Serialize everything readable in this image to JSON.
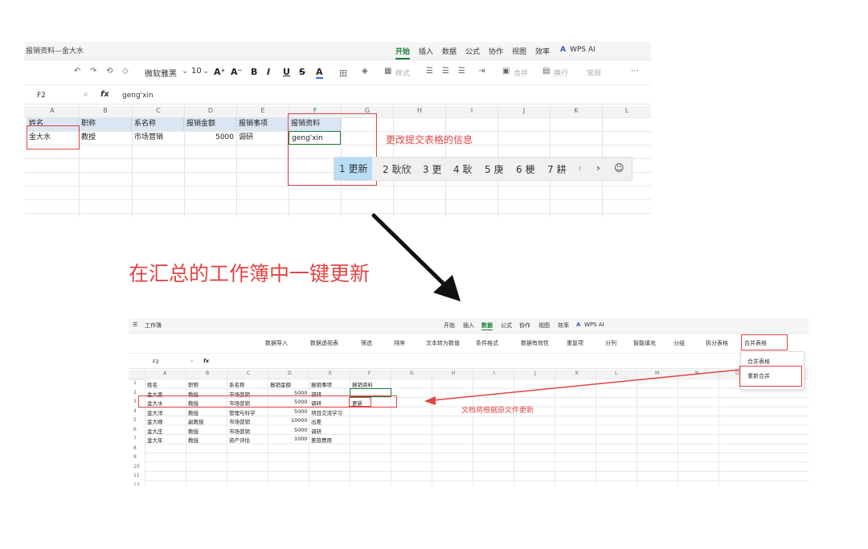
{
  "top": {
    "doc_title": "报销资料—金大水",
    "menu": [
      "开始",
      "插入",
      "数据",
      "公式",
      "协作",
      "视图",
      "效率",
      "WPS AI"
    ],
    "toolbar": {
      "font": "微软雅黑",
      "size": "10",
      "grow": "A⁺",
      "shrink": "A⁻",
      "bold": "B",
      "italic": "I",
      "underline": "U",
      "strike": "S",
      "color": "A",
      "style": "样式",
      "merge": "合并",
      "wrap": "换行",
      "format": "常规"
    },
    "cell_ref": "F2",
    "formula_value": "geng'xin",
    "columns": [
      "A",
      "B",
      "C",
      "D",
      "E",
      "F",
      "G",
      "H",
      "I",
      "J",
      "K",
      "L"
    ],
    "header_row": [
      "姓名",
      "职称",
      "系名称",
      "报销金额",
      "报销事项",
      "报销资料"
    ],
    "data_row": [
      "金大水",
      "教授",
      "市场营销",
      "5000",
      "调研",
      "geng'xin"
    ],
    "ime_candidates": [
      "1 更新",
      "2 耿欣",
      "3 更",
      "4 耿",
      "5 庚",
      "6 梗",
      "7 耕",
      "‹",
      "›",
      "☺"
    ]
  },
  "annotations": {
    "edit_note": "更改提交表格的信息",
    "headline": "在汇总的工作簿中一键更新",
    "update_note": "文档将根据原文件更新"
  },
  "bottom": {
    "title": "工作簿",
    "menu": [
      "开始",
      "插入",
      "数据",
      "公式",
      "协作",
      "视图",
      "效率",
      "WPS AI"
    ],
    "toolbar": [
      "数据导入",
      "数据透视表",
      "筛选",
      "排序",
      "文本转为数值",
      "条件格式",
      "数据有效性",
      "重复项",
      "分列",
      "智能填充",
      "分组",
      "拆分表格",
      "合并表格"
    ],
    "cell_ref": "F2",
    "columns": [
      "A",
      "B",
      "C",
      "D",
      "E",
      "F",
      "G",
      "H",
      "I",
      "J",
      "K",
      "L",
      "M",
      "N",
      "O"
    ],
    "rows": [
      [
        "姓名",
        "职称",
        "系名称",
        "报销金额",
        "报销事项",
        "报销资料"
      ],
      [
        "金大姜",
        "教授",
        "市场营销",
        "5000",
        "调研",
        ""
      ],
      [
        "金大水",
        "教授",
        "市场营销",
        "5000",
        "调研",
        "更新"
      ],
      [
        "金大洋",
        "教授",
        "管理与科学",
        "5000",
        "项目交流学习",
        ""
      ],
      [
        "金大顺",
        "副教授",
        "市场营销",
        "10000",
        "出差",
        ""
      ],
      [
        "金大庄",
        "教授",
        "市场营销",
        "5000",
        "调研",
        ""
      ],
      [
        "金大年",
        "教授",
        "资产评估",
        "1000",
        "差旅费用",
        ""
      ]
    ],
    "row_numbers": [
      "1",
      "2",
      "3",
      "4",
      "5",
      "6",
      "7",
      "8",
      "9",
      "10",
      "11",
      "12"
    ],
    "dropdown": [
      "合并表格",
      "重新合并"
    ]
  }
}
